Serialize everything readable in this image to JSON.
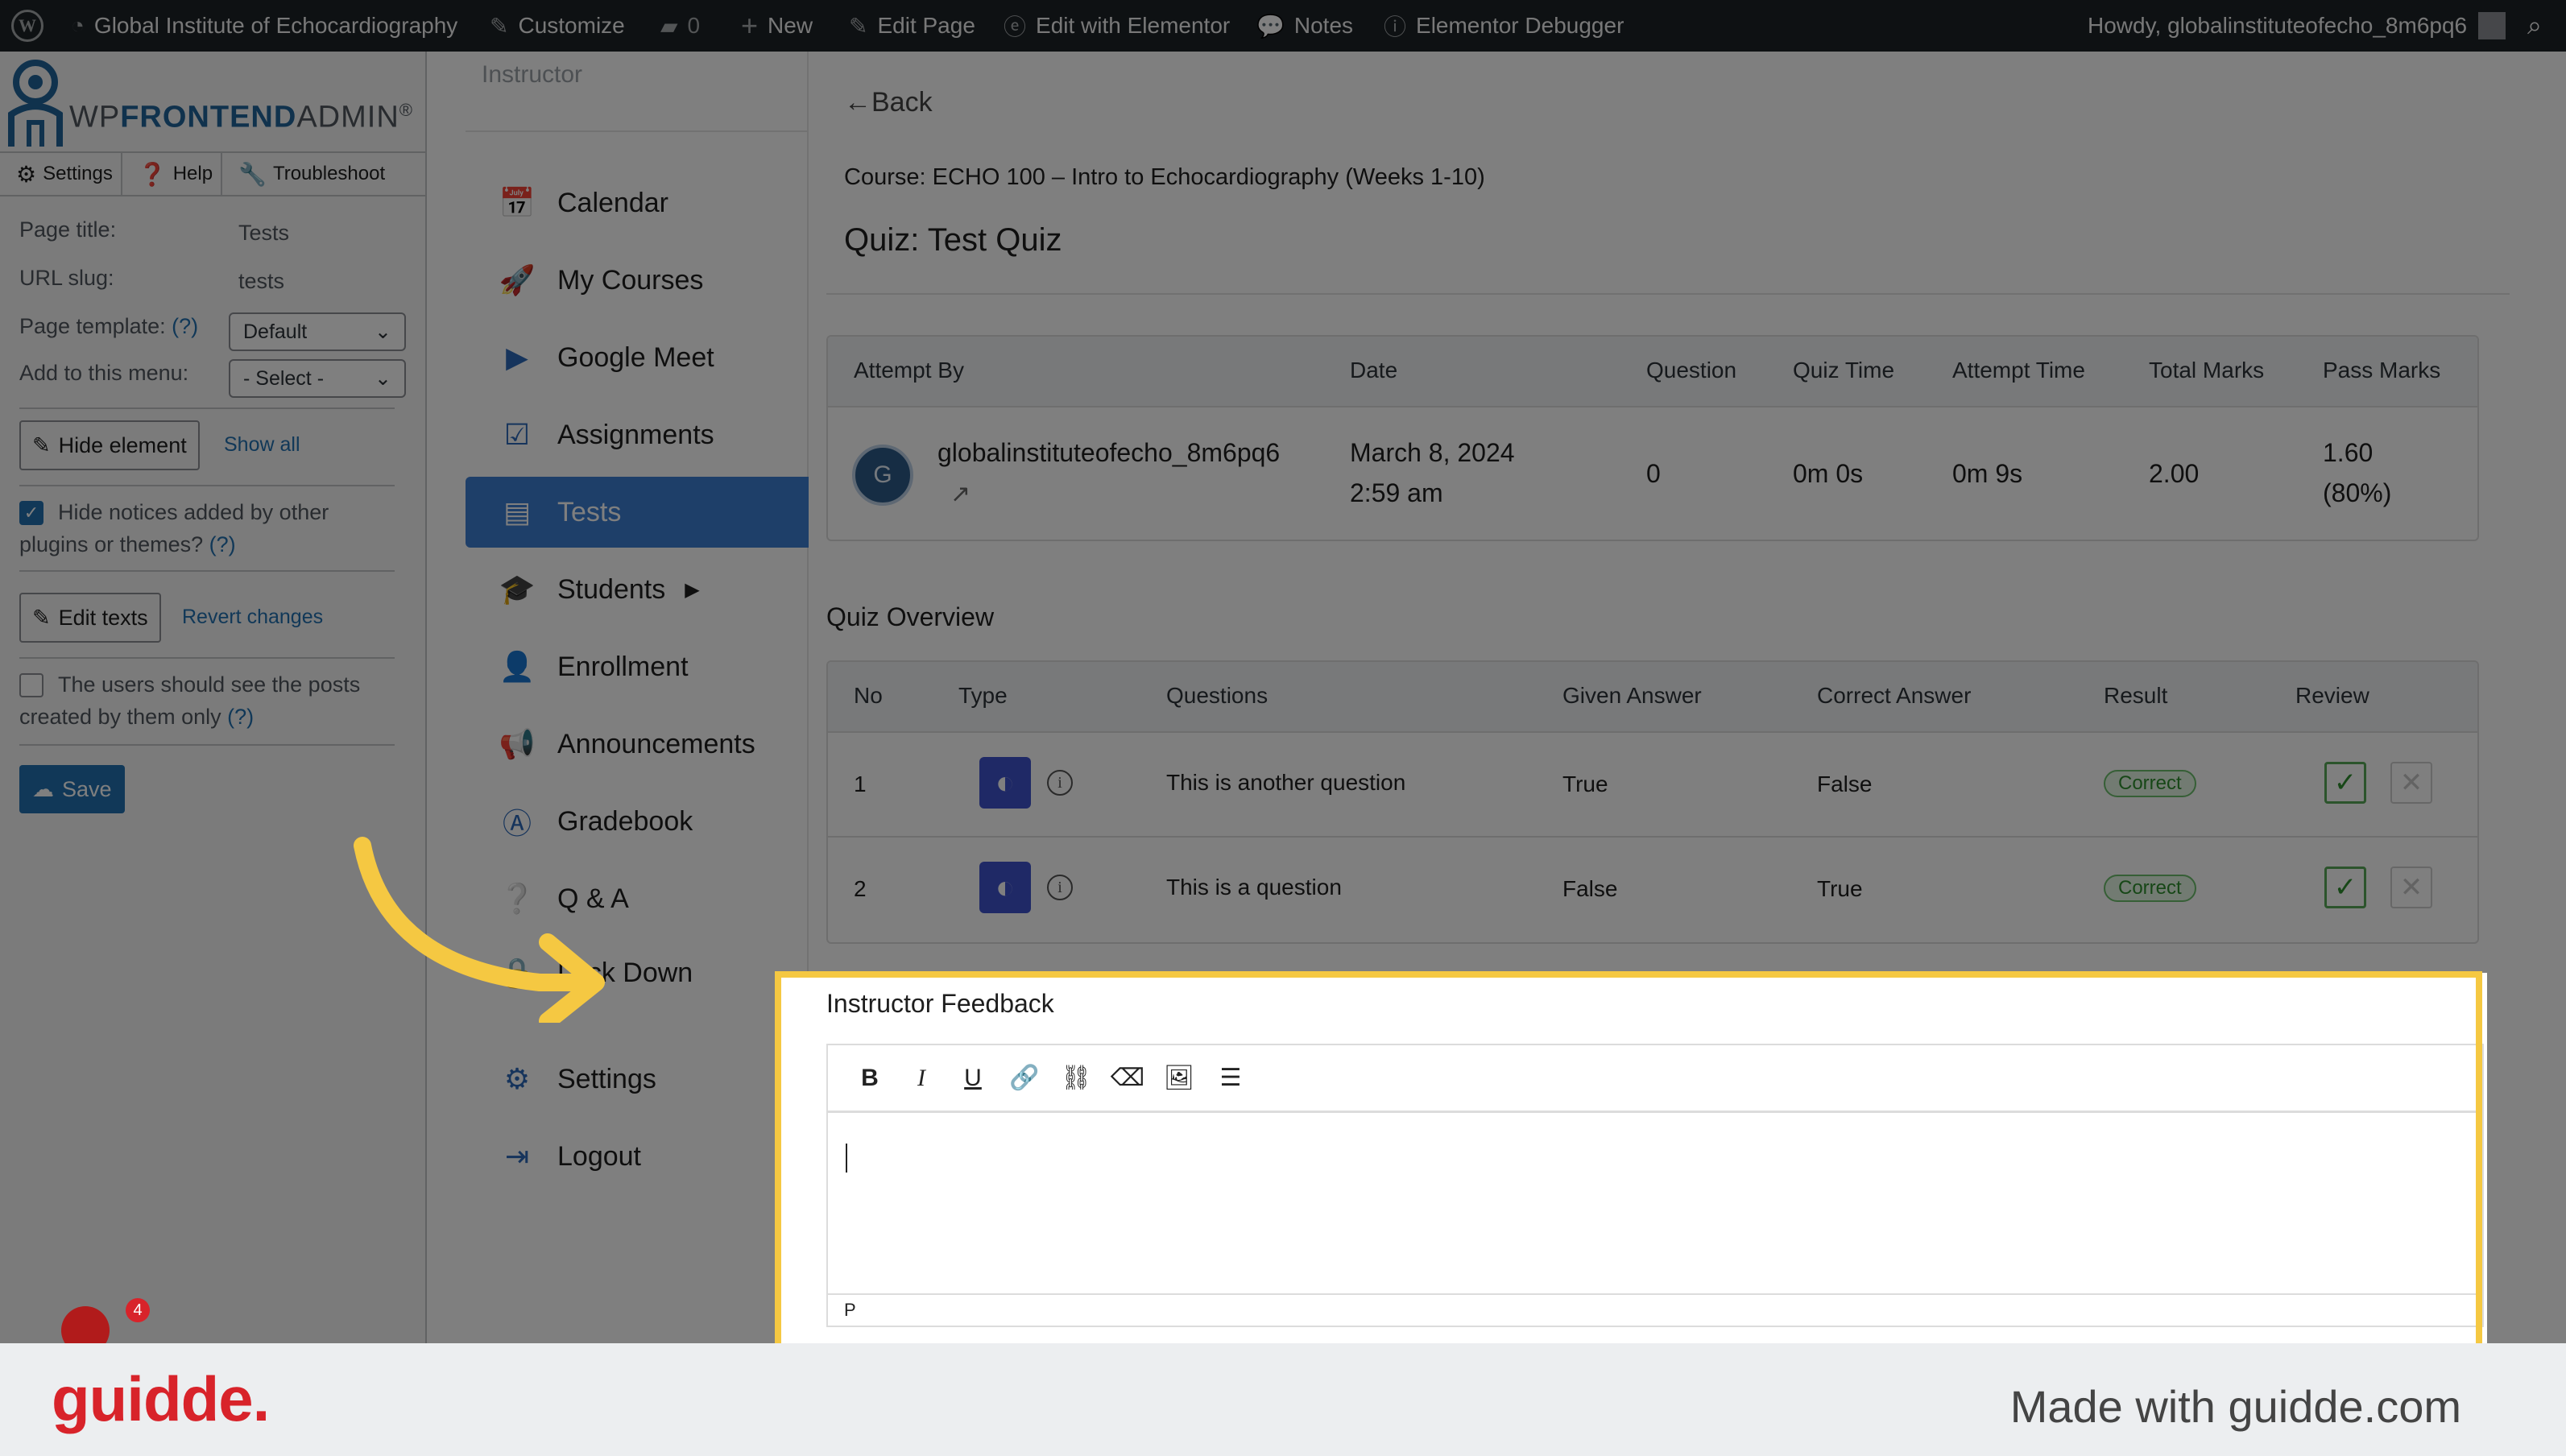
{
  "adminbar": {
    "site_name": "Global Institute of Echocardiography",
    "customize": "Customize",
    "comments_count": "0",
    "new": "New",
    "edit_page": "Edit Page",
    "edit_elementor": "Edit with Elementor",
    "notes": "Notes",
    "debugger": "Elementor Debugger",
    "howdy": "Howdy, globalinstituteofecho_8m6pq6"
  },
  "wpfa": {
    "logo_wp": "WP",
    "logo_frontend": "FRONTEND",
    "logo_admin": "ADMIN",
    "logo_reg": "®",
    "tabs": [
      "Settings",
      "Help",
      "Troubleshoot"
    ],
    "page_title_label": "Page title:",
    "page_title_value": "Tests",
    "url_slug_label": "URL slug:",
    "url_slug_value": "tests",
    "template_label": "Page template:",
    "help_mark": "(?)",
    "template_value": "Default",
    "menu_label": "Add to this menu:",
    "menu_value": "- Select -",
    "hide_element": "Hide element",
    "show_all": "Show all",
    "hide_notices": "Hide notices added by other plugins or themes?",
    "edit_texts": "Edit texts",
    "revert_changes": "Revert changes",
    "users_posts": "The users should see the posts created by them only",
    "save": "Save"
  },
  "nav": {
    "heading": "Instructor",
    "items": [
      {
        "label": "Calendar"
      },
      {
        "label": "My Courses"
      },
      {
        "label": "Google Meet"
      },
      {
        "label": "Assignments"
      },
      {
        "label": "Tests"
      },
      {
        "label": "Students"
      },
      {
        "label": "Enrollment"
      },
      {
        "label": "Announcements"
      },
      {
        "label": "Gradebook"
      },
      {
        "label": "Q & A"
      },
      {
        "label": "Lock Down"
      },
      {
        "label": "Settings"
      },
      {
        "label": "Logout"
      }
    ]
  },
  "main": {
    "back": "Back",
    "course": "Course: ECHO 100 – Intro to Echocardiography (Weeks 1-10)",
    "quiz_title": "Quiz: Test Quiz",
    "attempt_headers": [
      "Attempt By",
      "Date",
      "Question",
      "Quiz Time",
      "Attempt Time",
      "Total Marks",
      "Pass Marks"
    ],
    "attempt": {
      "avatar": "G",
      "user": "globalinstituteofecho_8m6pq6",
      "date_line1": "March 8, 2024",
      "date_line2": "2:59 am",
      "question": "0",
      "quiz_time": "0m 0s",
      "attempt_time": "0m 9s",
      "total_marks": "2.00",
      "pass_marks_line1": "1.60",
      "pass_marks_line2": "(80%)"
    },
    "overview_title": "Quiz Overview",
    "overview_headers": [
      "No",
      "Type",
      "Questions",
      "Given Answer",
      "Correct Answer",
      "Result",
      "Review"
    ],
    "overview_rows": [
      {
        "no": "1",
        "question": "This is another question",
        "given": "True",
        "correct": "False",
        "result": "Correct"
      },
      {
        "no": "2",
        "question": "This is a question",
        "given": "False",
        "correct": "True",
        "result": "Correct"
      }
    ],
    "feedback_title": "Instructor Feedback",
    "editor_status": "P"
  },
  "footer": {
    "logo": "guidde.",
    "made_with": "Made with guidde.com",
    "notification_count": "4"
  },
  "colors": {
    "admin_bar": "#1d2327",
    "nav_active": "#3d7ed3",
    "highlight": "#f5c842",
    "brand_red": "#d8232a"
  }
}
